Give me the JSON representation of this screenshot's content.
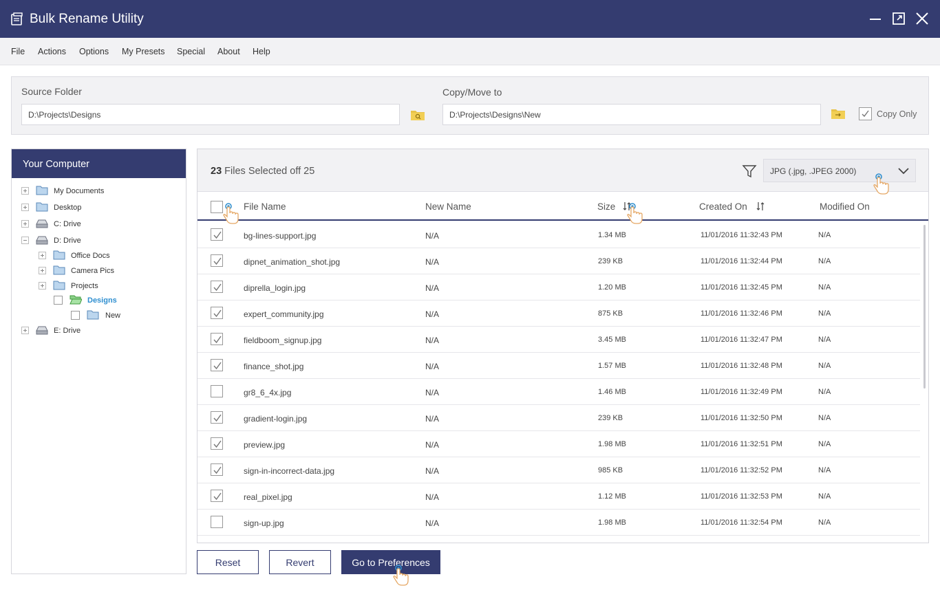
{
  "window": {
    "title": "Bulk Rename Utility"
  },
  "menu": [
    "File",
    "Actions",
    "Options",
    "My Presets",
    "Special",
    "About",
    "Help"
  ],
  "source": {
    "label": "Source Folder",
    "value": "D:\\Projects\\Designs"
  },
  "target": {
    "label": "Copy/Move to",
    "value": "D:\\Projects\\Designs\\New"
  },
  "copy_only": {
    "label": "Copy Only",
    "checked": true
  },
  "sidebar": {
    "title": "Your Computer",
    "tree": [
      {
        "label": "My Documents",
        "type": "folder"
      },
      {
        "label": "Desktop",
        "type": "folder"
      },
      {
        "label": "C: Drive",
        "type": "drive"
      },
      {
        "label": "D: Drive",
        "type": "drive"
      },
      {
        "label": "Office Docs",
        "type": "folder"
      },
      {
        "label": "Camera Pics",
        "type": "folder"
      },
      {
        "label": "Projects",
        "type": "folder"
      },
      {
        "label": "Designs",
        "type": "folder-open",
        "active": true
      },
      {
        "label": "New",
        "type": "folder"
      },
      {
        "label": "E: Drive",
        "type": "drive"
      }
    ]
  },
  "files": {
    "selected_count": "23",
    "selected_suffix": "Files Selected off 25",
    "filter_value": "JPG (.jpg, .JPEG 2000)",
    "columns": [
      "File Name",
      "New Name",
      "Size",
      "Created On",
      "Modified On"
    ],
    "rows": [
      {
        "checked": true,
        "name": "bg-lines-support.jpg",
        "new_name": "N/A",
        "size": "1.34 MB",
        "created": "11/01/2016 11:32:43 PM",
        "modified": "N/A"
      },
      {
        "checked": true,
        "name": "dipnet_animation_shot.jpg",
        "new_name": "N/A",
        "size": "239 KB",
        "created": "11/01/2016 11:32:44 PM",
        "modified": "N/A"
      },
      {
        "checked": true,
        "name": "diprella_login.jpg",
        "new_name": "N/A",
        "size": "1.20 MB",
        "created": "11/01/2016 11:32:45 PM",
        "modified": "N/A"
      },
      {
        "checked": true,
        "name": "expert_community.jpg",
        "new_name": "N/A",
        "size": "875 KB",
        "created": "11/01/2016 11:32:46 PM",
        "modified": "N/A"
      },
      {
        "checked": true,
        "name": "fieldboom_signup.jpg",
        "new_name": "N/A",
        "size": "3.45 MB",
        "created": "11/01/2016 11:32:47 PM",
        "modified": "N/A"
      },
      {
        "checked": true,
        "name": "finance_shot.jpg",
        "new_name": "N/A",
        "size": "1.57 MB",
        "created": "11/01/2016 11:32:48 PM",
        "modified": "N/A"
      },
      {
        "checked": false,
        "name": "gr8_6_4x.jpg",
        "new_name": "N/A",
        "size": "1.46 MB",
        "created": "11/01/2016 11:32:49 PM",
        "modified": "N/A"
      },
      {
        "checked": true,
        "name": "gradient-login.jpg",
        "new_name": "N/A",
        "size": "239 KB",
        "created": "11/01/2016 11:32:50 PM",
        "modified": "N/A"
      },
      {
        "checked": true,
        "name": "preview.jpg",
        "new_name": "N/A",
        "size": "1.98 MB",
        "created": "11/01/2016 11:32:51 PM",
        "modified": "N/A"
      },
      {
        "checked": true,
        "name": "sign-in-incorrect-data.jpg",
        "new_name": "N/A",
        "size": "985 KB",
        "created": "11/01/2016 11:32:52 PM",
        "modified": "N/A"
      },
      {
        "checked": true,
        "name": "real_pixel.jpg",
        "new_name": "N/A",
        "size": "1.12 MB",
        "created": "11/01/2016 11:32:53 PM",
        "modified": "N/A"
      },
      {
        "checked": false,
        "name": "sign-up.jpg",
        "new_name": "N/A",
        "size": "1.98 MB",
        "created": "11/01/2016 11:32:54 PM",
        "modified": "N/A"
      }
    ]
  },
  "buttons": {
    "reset": "Reset",
    "revert": "Revert",
    "preferences": "Go to Preferences"
  },
  "colors": {
    "primary": "#343c70",
    "folder": "#e8c34a",
    "active_link": "#2f8fd0",
    "hint": "#2f8fd0"
  },
  "icons": [
    "app-icon",
    "minimize-icon",
    "maximize-icon",
    "close-icon",
    "folder-search-icon",
    "folder-move-icon",
    "filter-icon",
    "chevron-down-icon",
    "sort-icon",
    "tap-hint-icon"
  ]
}
